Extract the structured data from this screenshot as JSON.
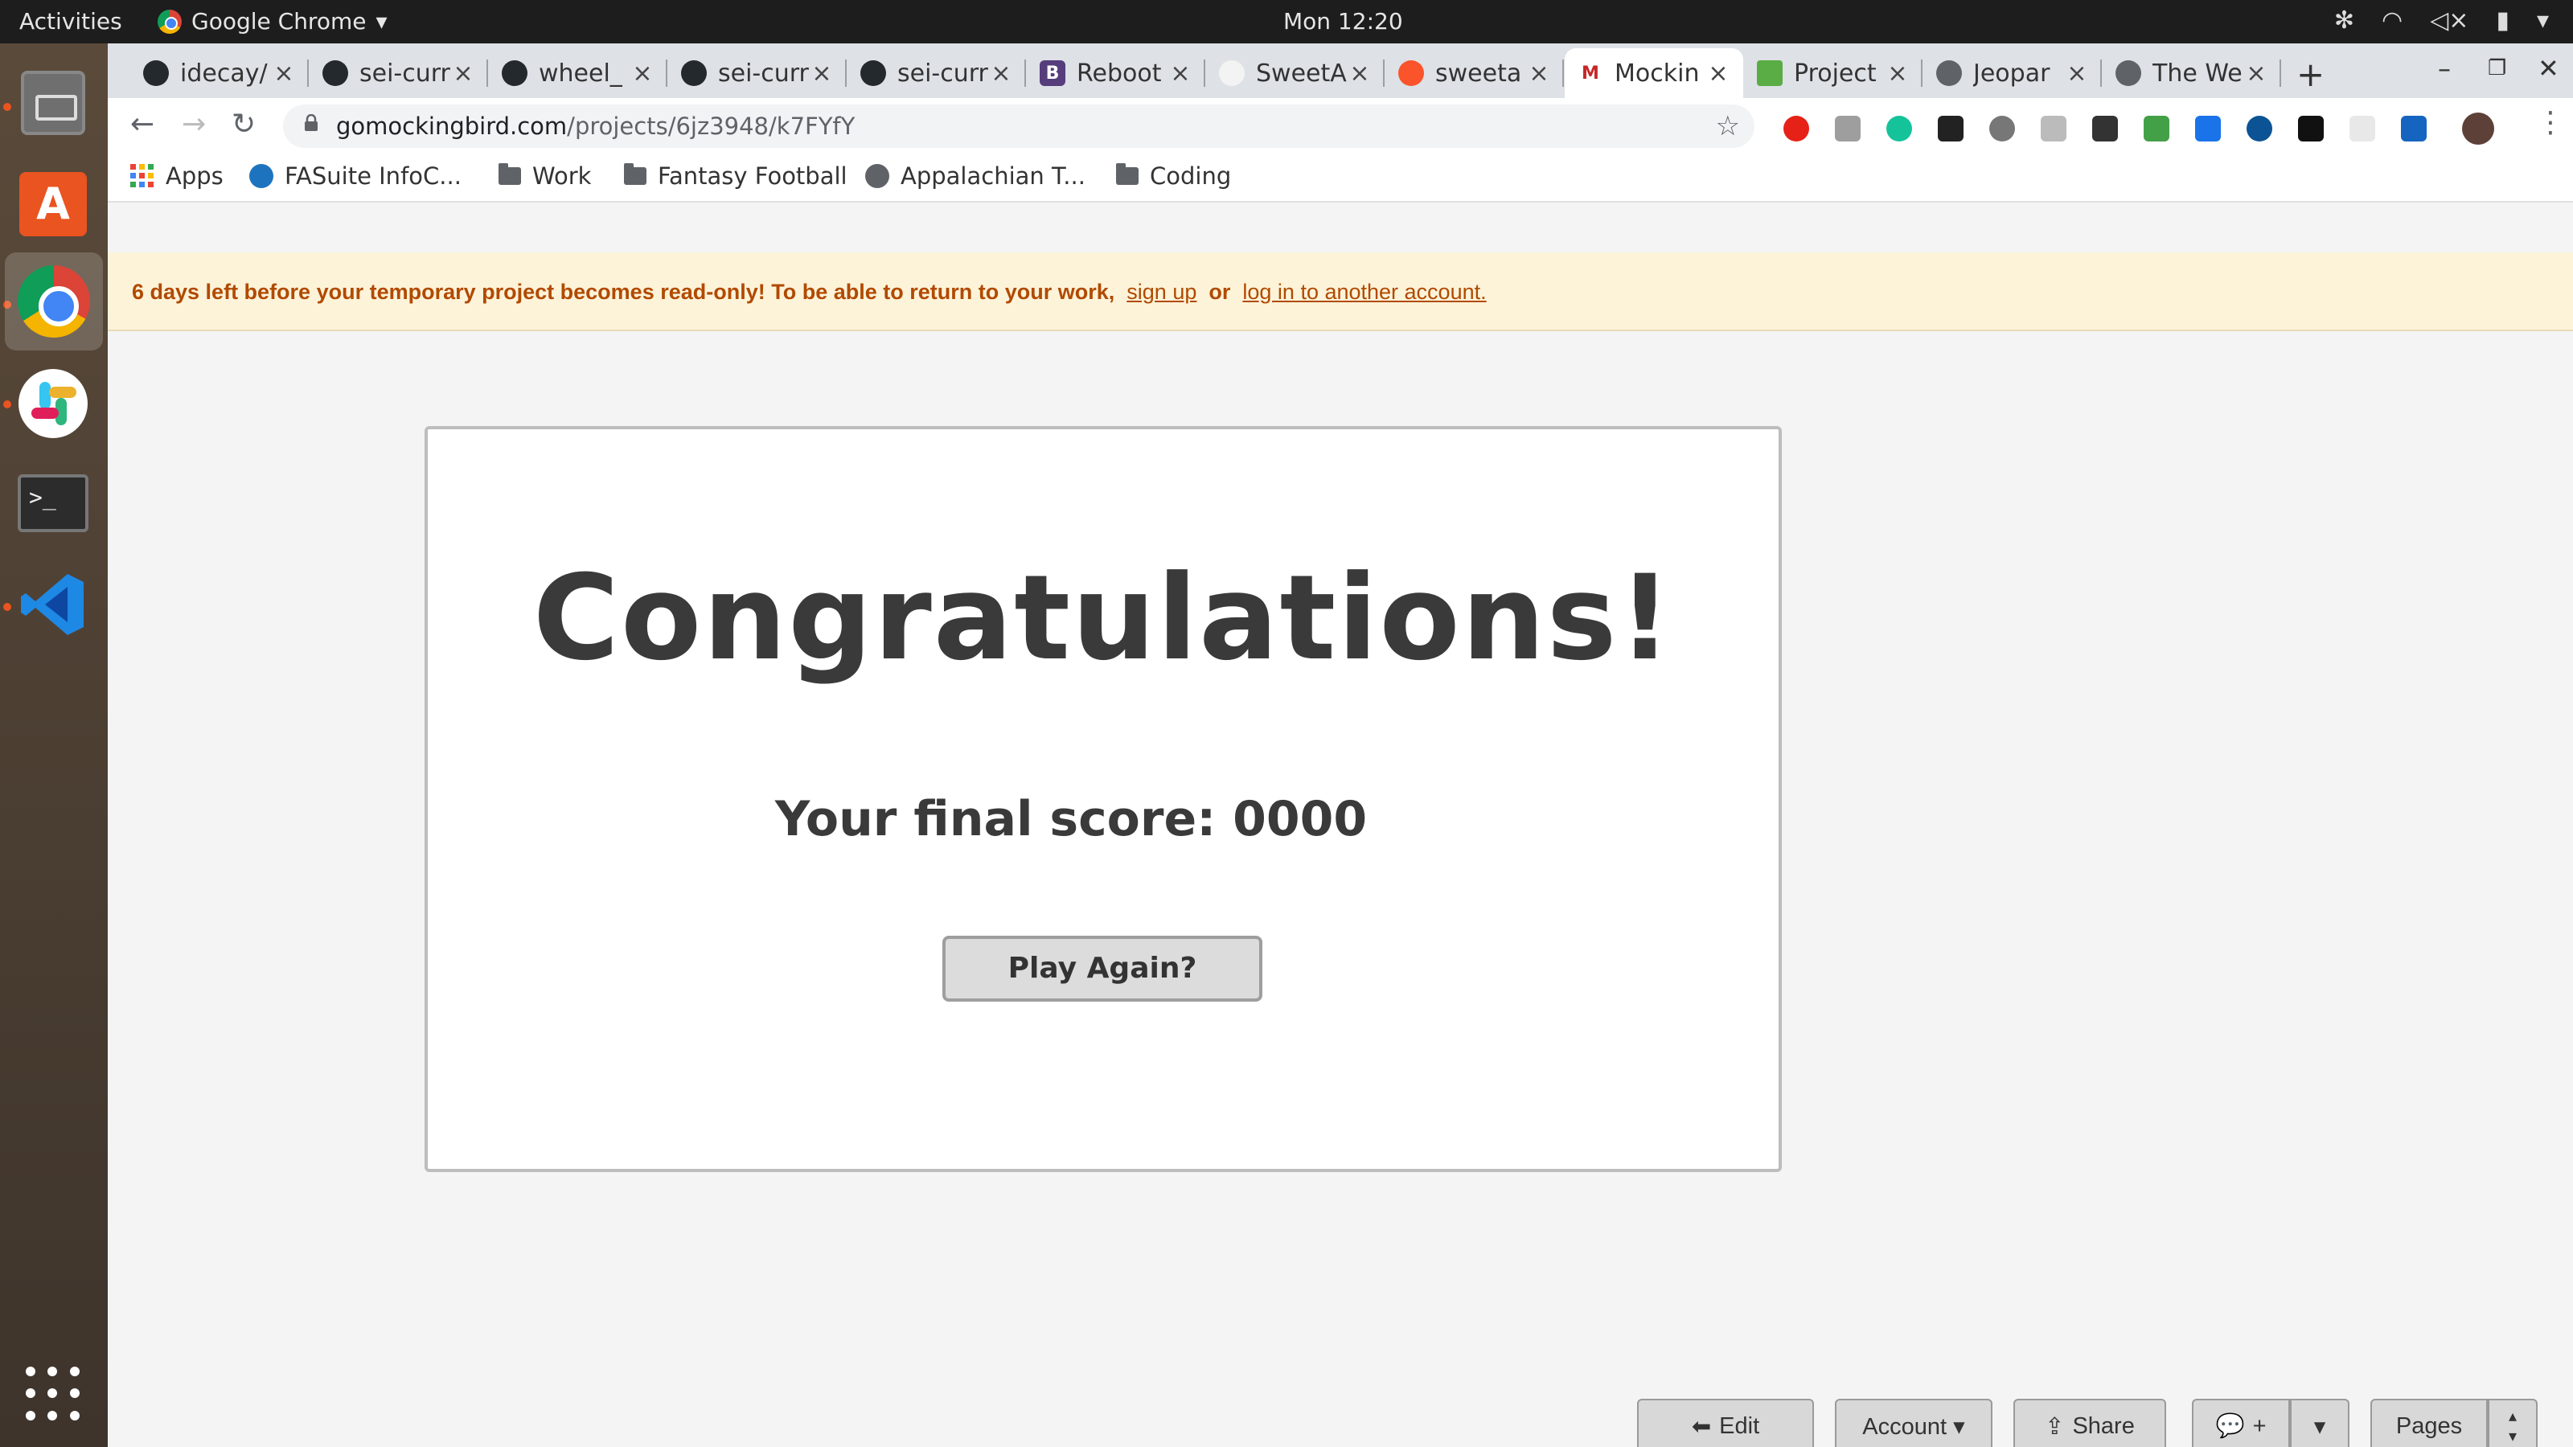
{
  "system": {
    "activities": "Activities",
    "app_name": "Google Chrome",
    "clock": "Mon 12:20"
  },
  "tabs": [
    {
      "title": "idecay/",
      "icon": "github-icon"
    },
    {
      "title": "sei-curr",
      "icon": "github-icon"
    },
    {
      "title": "wheel_",
      "icon": "github-icon"
    },
    {
      "title": "sei-curr",
      "icon": "github-icon"
    },
    {
      "title": "sei-curr",
      "icon": "github-icon"
    },
    {
      "title": "Reboot",
      "icon": "bootstrap-icon"
    },
    {
      "title": "SweetA",
      "icon": "sweetalert-icon"
    },
    {
      "title": "sweeta",
      "icon": "brave-icon"
    },
    {
      "title": "Mockin",
      "icon": "mockingbird-icon"
    },
    {
      "title": "Project",
      "icon": "trello-icon"
    },
    {
      "title": "Jeopar",
      "icon": "globe-icon"
    },
    {
      "title": "The We",
      "icon": "globe-icon"
    }
  ],
  "address": {
    "domain": "gomockingbird.com",
    "path": "/projects/6jz3948/k7FYfY"
  },
  "bookmarks": [
    {
      "label": "Apps",
      "icon": "apps-grid-icon"
    },
    {
      "label": "FASuite InfoC...",
      "icon": "fasuite-icon"
    },
    {
      "label": "Work",
      "icon": "folder-icon"
    },
    {
      "label": "Fantasy Football",
      "icon": "folder-icon"
    },
    {
      "label": "Appalachian T...",
      "icon": "globe-icon"
    },
    {
      "label": "Coding",
      "icon": "folder-icon"
    }
  ],
  "banner": {
    "message": "6 days left before your temporary project becomes read-only! To be able to return to your work,",
    "signup": "sign up",
    "or": "or",
    "login": "log in to another account."
  },
  "card": {
    "heading": "Congratulations!",
    "score_text": "Your final score: 0000",
    "play_again": "Play Again?"
  },
  "mockingbird_toolbar": {
    "edit": "Edit",
    "account": "Account ▾",
    "share": "Share",
    "comment": "+",
    "dropdown": "▾",
    "pages": "Pages"
  },
  "colors": {
    "banner_text": "#b14a00",
    "banner_bg": "#fdf3d9",
    "heading": "#3a3a3a"
  }
}
